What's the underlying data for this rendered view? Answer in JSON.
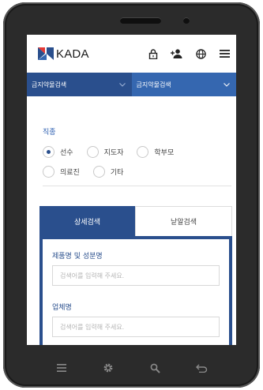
{
  "header": {
    "logo_text": "KADA",
    "icons": [
      "lock-icon",
      "add-user-icon",
      "globe-icon",
      "menu-icon"
    ]
  },
  "selects": {
    "left_label": "금지약물검색",
    "right_label": "금지약물검색"
  },
  "job_type": {
    "title": "직종",
    "options": [
      {
        "label": "선수",
        "selected": true
      },
      {
        "label": "지도자",
        "selected": false
      },
      {
        "label": "학부모",
        "selected": false
      },
      {
        "label": "의료진",
        "selected": false
      },
      {
        "label": "기타",
        "selected": false
      }
    ]
  },
  "search_tabs": {
    "detail_label": "상세검색",
    "alpha_label": "낱알검색"
  },
  "form": {
    "product_label": "제품명 및 성분명",
    "product_placeholder": "검색어를 입력해 주세요.",
    "company_label": "업체명",
    "company_placeholder": "검색어를 입력해 주세요."
  },
  "colors": {
    "brand_dark_blue": "#2a4f8d",
    "brand_blue": "#3567b0",
    "accent_text_blue": "#2a5db0",
    "logo_red": "#e53935",
    "frame": "#2b2b2b"
  },
  "navbar": {
    "icons": [
      "menu-icon",
      "settings-icon",
      "search-icon",
      "back-icon"
    ]
  }
}
